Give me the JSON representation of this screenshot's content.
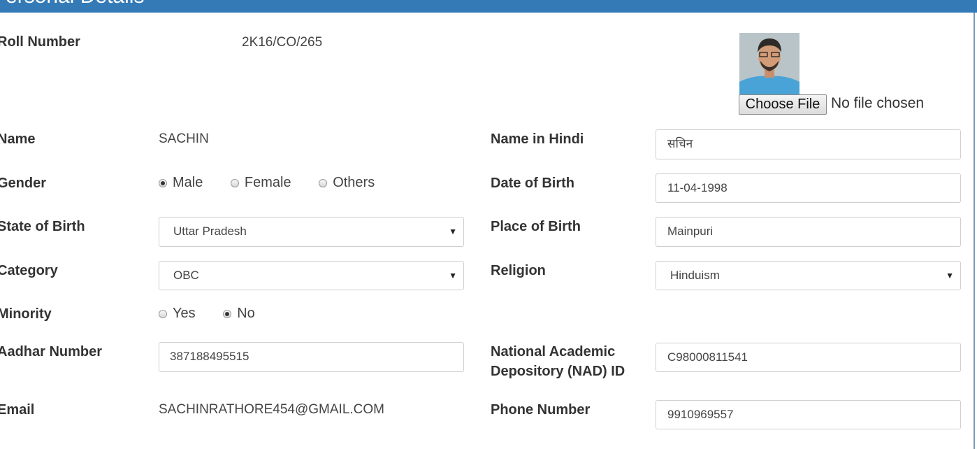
{
  "header": {
    "title": "Personal Details"
  },
  "photo": {
    "alt": "profile-photo"
  },
  "file_input": {
    "button_label": "Choose File",
    "status": "No file chosen"
  },
  "fields": {
    "roll_number": {
      "label": "Roll Number",
      "value": "2K16/CO/265"
    },
    "name": {
      "label": "Name",
      "value": "SACHIN"
    },
    "name_hindi": {
      "label": "Name in Hindi",
      "value": "सचिन"
    },
    "gender": {
      "label": "Gender",
      "options": [
        "Male",
        "Female",
        "Others"
      ],
      "selected": "Male"
    },
    "dob": {
      "label": "Date of Birth",
      "value": "11-04-1998"
    },
    "state_of_birth": {
      "label": "State of Birth",
      "value": "Uttar Pradesh"
    },
    "place_of_birth": {
      "label": "Place of Birth",
      "value": "Mainpuri"
    },
    "category": {
      "label": "Category",
      "value": "OBC"
    },
    "religion": {
      "label": "Religion",
      "value": "Hinduism"
    },
    "minority": {
      "label": "Minority",
      "options": [
        "Yes",
        "No"
      ],
      "selected": "No"
    },
    "aadhar": {
      "label": "Aadhar Number",
      "value": "387188495515"
    },
    "nad_id": {
      "label": "National Academic Depository (NAD) ID",
      "value": "C98000811541"
    },
    "email": {
      "label": "Email",
      "value": "SACHINRATHORE454@GMAIL.COM"
    },
    "phone": {
      "label": "Phone Number",
      "value": "9910969557"
    }
  },
  "colors": {
    "header_bg": "#337ab7",
    "photo_bg": "#5aa9d8"
  }
}
